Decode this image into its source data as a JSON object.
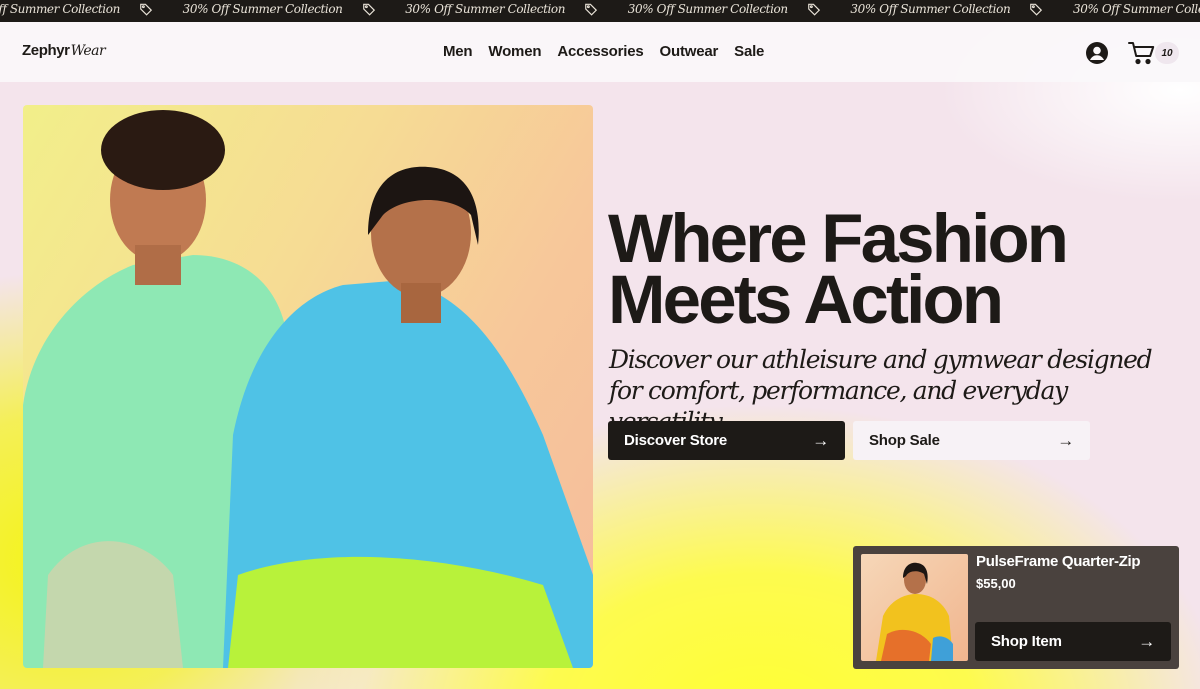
{
  "promo": {
    "items": [
      "30% Off Summer Collection",
      "30% Off Summer Collection",
      "30% Off Summer Collection",
      "30% Off Summer Collection",
      "30% Off Summer Collection",
      "30% Off Summer Collection"
    ],
    "icon": "tag-icon"
  },
  "header": {
    "logo_bold": "Zephyr",
    "logo_italic": "Wear",
    "nav": [
      "Men",
      "Women",
      "Accessories",
      "Outwear",
      "Sale"
    ],
    "account_icon": "user-icon",
    "cart_icon": "cart-icon",
    "cart_count": "10"
  },
  "hero": {
    "image": "models-in-hoodie-and-jacket-photo",
    "headline_line1": "Where Fashion",
    "headline_line2": "Meets Action",
    "subhead": "Discover our athleisure and gymwear designed for comfort, performance, and everyday versatility.",
    "primary_button": "Discover Store",
    "secondary_button": "Shop Sale",
    "arrow": "→"
  },
  "product_card": {
    "image": "model-in-colorblock-quarter-zip-photo",
    "name": "PulseFrame Quarter-Zip",
    "price": "$55,00",
    "button": "Shop Item",
    "arrow": "→"
  },
  "colors": {
    "dark": "#1d1a17",
    "page_background": "#f4e4ec",
    "accent_yellow": "#ffff33",
    "card_background": "#4a423e"
  }
}
